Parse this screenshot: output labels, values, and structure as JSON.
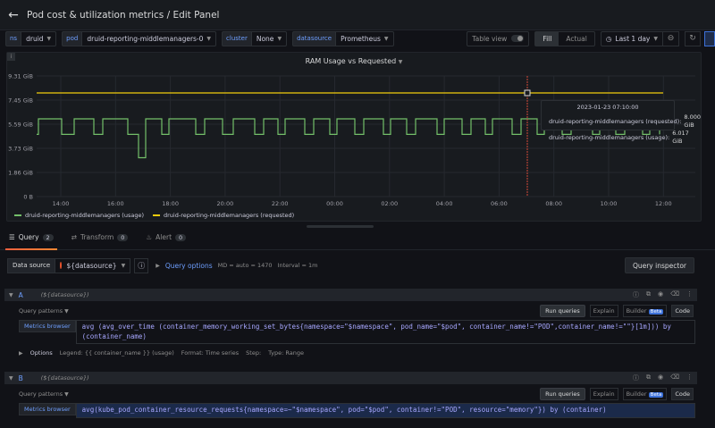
{
  "header": {
    "title": "Pod cost & utilization metrics / Edit Panel"
  },
  "variables": [
    {
      "label": "ns",
      "value": "druid"
    },
    {
      "label": "pod",
      "value": "druid-reporting-middlemanagers-0"
    },
    {
      "label": "cluster",
      "value": "None"
    },
    {
      "label": "datasource",
      "value": "Prometheus"
    }
  ],
  "controls": {
    "table_view": "Table view",
    "fill": "Fill",
    "actual": "Actual",
    "time_range": "Last 1 day"
  },
  "panel": {
    "title": "RAM Usage vs Requested",
    "tooltip": {
      "time": "2023-01-23 07:10:00",
      "rows": [
        {
          "name": "druid-reporting-middlemanagers (requested):",
          "value": "8.000 GiB",
          "color": "#f2cc0c"
        },
        {
          "name": "druid-reporting-middlemanagers (usage):",
          "value": "6.017 GiB",
          "color": "#73bf69"
        }
      ]
    }
  },
  "chart_data": {
    "type": "line",
    "title": "RAM Usage vs Requested",
    "y_ticks": [
      "0 B",
      "1.86 GiB",
      "3.73 GiB",
      "5.59 GiB",
      "7.45 GiB",
      "9.31 GiB"
    ],
    "x_ticks": [
      "14:00",
      "16:00",
      "18:00",
      "20:00",
      "22:00",
      "00:00",
      "02:00",
      "04:00",
      "06:00",
      "08:00",
      "10:00",
      "12:00"
    ],
    "ylim": [
      0,
      9.31
    ],
    "series": [
      {
        "name": "druid-reporting-middlemanagers (usage)",
        "color": "#73bf69",
        "high": 6.0,
        "low": 4.8,
        "dip": 3.0
      },
      {
        "name": "druid-reporting-middlemanagers (requested)",
        "color": "#f2cc0c",
        "value": 8.0
      }
    ],
    "legend_position": "bottom-left"
  },
  "tabs": [
    {
      "label": "Query",
      "count": "2"
    },
    {
      "label": "Transform",
      "count": "0"
    },
    {
      "label": "Alert",
      "count": "0"
    }
  ],
  "datasource_row": {
    "label": "Data source",
    "value": "${datasource}",
    "query_options": "Query options",
    "md": "MD = auto = 1470",
    "interval": "Interval = 1m",
    "inspector": "Query inspector"
  },
  "queries": [
    {
      "ref": "A",
      "ds": "(${datasource})",
      "patterns": "Query patterns",
      "run": "Run queries",
      "explain": "Explain",
      "builder": "Builder",
      "beta": "Beta",
      "code": "Code",
      "metrics_browser": "Metrics browser",
      "expr_line1": "avg (avg_over_time (container_memory_working_set_bytes{namespace=\"$namespace\", pod_name=\"$pod\", container_name!=\"POD\",container_name!=\"\"}[1m])) by",
      "expr_line2": "(container_name)",
      "options_title": "Options",
      "legend": "Legend: {{ container_name }} (usage)",
      "format": "Format: Time series",
      "step": "Step:",
      "qtype": "Type: Range"
    },
    {
      "ref": "B",
      "ds": "(${datasource})",
      "patterns": "Query patterns",
      "run": "Run queries",
      "explain": "Explain",
      "builder": "Builder",
      "beta": "Beta",
      "code": "Code",
      "metrics_browser": "Metrics browser",
      "expr_line1": "avg(kube_pod_container_resource_requests{namespace=~\"$namespace\", pod=\"$pod\", container!=\"POD\", resource=\"memory\"}) by (container)"
    }
  ]
}
